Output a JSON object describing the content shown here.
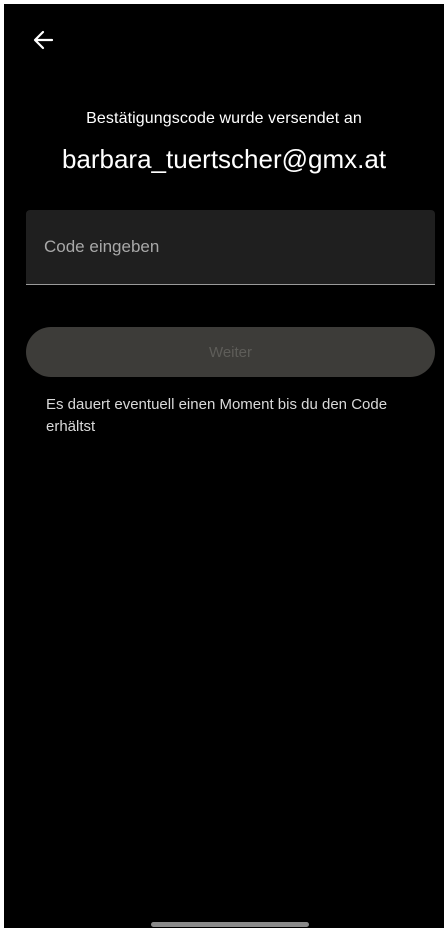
{
  "header": {
    "back_icon": "arrow-left-icon"
  },
  "confirmation": {
    "subtitle": "Bestätigungscode wurde versendet an",
    "email": "barbara_tuertscher@gmx.at"
  },
  "code_input": {
    "placeholder": "Code eingeben",
    "value": ""
  },
  "next_button": {
    "label": "Weiter",
    "enabled": false
  },
  "hint": "Es dauert eventuell einen Moment bis du den Code erhältst",
  "colors": {
    "background": "#000000",
    "field_background": "#1f1f1f",
    "button_disabled_bg": "#3d3c39",
    "button_disabled_text": "#5e5d59",
    "text_primary": "#ffffff",
    "text_secondary": "#d9d9d9"
  }
}
